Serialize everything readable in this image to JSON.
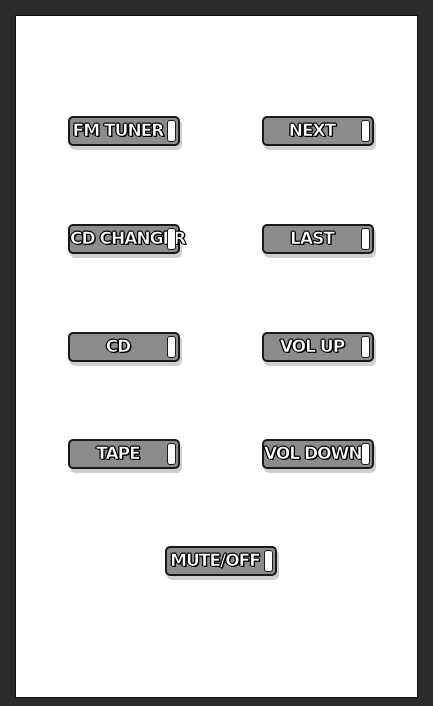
{
  "remote": {
    "buttons": {
      "fm_tuner": "FM TUNER",
      "next": "NEXT",
      "cd_changer": "CD CHANGER",
      "last": "LAST",
      "cd": "CD",
      "vol_up": "VOL UP",
      "tape": "TAPE",
      "vol_down": "VOL DOWN",
      "mute_off": "MUTE/OFF"
    }
  }
}
